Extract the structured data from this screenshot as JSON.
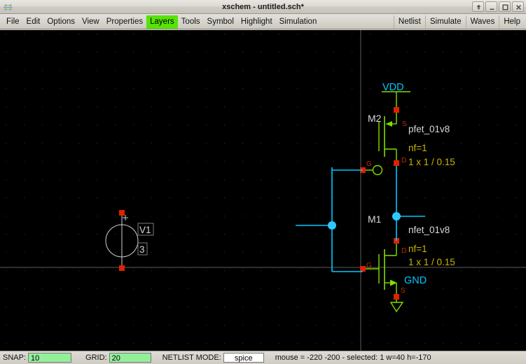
{
  "window": {
    "title": "xschem - untitled.sch*",
    "buttons": [
      {
        "name": "shade-button",
        "glyph": "shade"
      },
      {
        "name": "minimize-button",
        "glyph": "minimize"
      },
      {
        "name": "maximize-button",
        "glyph": "maximize"
      },
      {
        "name": "close-button",
        "glyph": "close"
      }
    ]
  },
  "menubar": {
    "left": [
      {
        "label": "File",
        "active": false
      },
      {
        "label": "Edit",
        "active": false
      },
      {
        "label": "Options",
        "active": false
      },
      {
        "label": "View",
        "active": false
      },
      {
        "label": "Properties",
        "active": false
      },
      {
        "label": "Layers",
        "active": true
      },
      {
        "label": "Tools",
        "active": false
      },
      {
        "label": "Symbol",
        "active": false
      },
      {
        "label": "Highlight",
        "active": false
      },
      {
        "label": "Simulation",
        "active": false
      }
    ],
    "right": [
      {
        "label": "Netlist"
      },
      {
        "label": "Simulate"
      },
      {
        "label": "Waves"
      },
      {
        "label": "Help"
      }
    ],
    "highlight_color": "#56e406"
  },
  "statusbar": {
    "snap_label": "SNAP:",
    "snap_value": "10",
    "grid_label": "GRID:",
    "grid_value": "20",
    "netlist_mode_label": "NETLIST MODE:",
    "netlist_mode_value": "spice",
    "mouse_info": "mouse = -220 -200 - selected: 1 w=40 h=-170",
    "field_color": "#93f09a"
  },
  "schematic": {
    "colors": {
      "background": "#000000",
      "grid_dot": "#2a2a2a",
      "axis": "#6a6a6a",
      "wire": "#00c8ff",
      "device": "#7fe000",
      "pin": "#ff2000",
      "pin_label": "#c03000",
      "instance_name": "#d8d8d8",
      "property_text": "#c8b400",
      "net_label": "#00c8ff",
      "selection_box": "#808080",
      "vsource": "#d8d8d8"
    },
    "labels": {
      "vdd": "VDD",
      "gnd": "GND",
      "m2_name": "M2",
      "m2_model": "pfet_01v8",
      "m2_nf": "nf=1",
      "m2_size": "1 x 1 / 0.15",
      "m1_name": "M1",
      "m1_model": "nfet_01v8",
      "m1_nf": "nf=1",
      "m1_size": "1 x 1 / 0.15",
      "v1_name": "V1",
      "v1_value": "3",
      "v1_plus": "+",
      "pin_g_upper": "G",
      "pin_s_upper": "S",
      "pin_d_upper": "D",
      "pin_g_lower": "G",
      "pin_s_lower": "S",
      "pin_d_lower": "D"
    }
  }
}
